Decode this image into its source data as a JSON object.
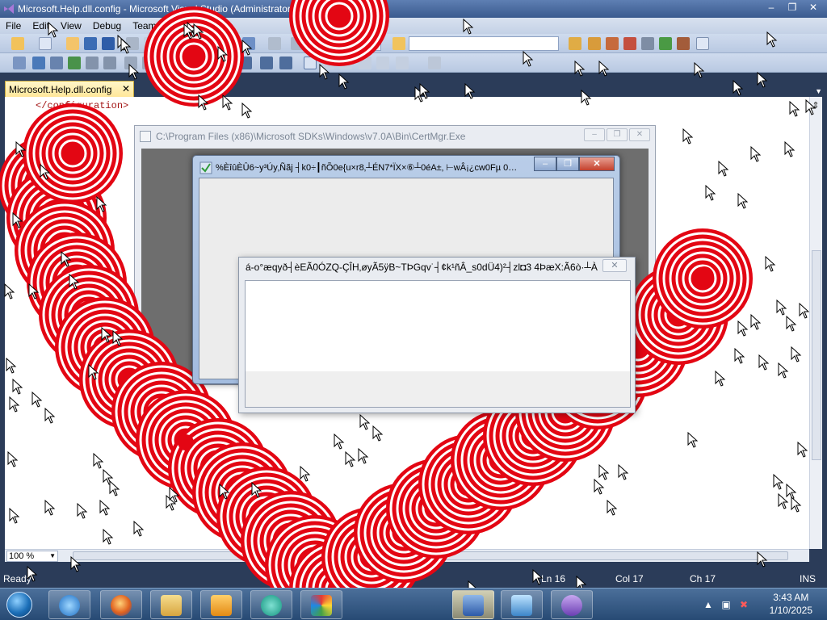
{
  "window": {
    "title": "Microsoft.Help.dll.config - Microsoft Visual Studio (Administrator)",
    "controls": [
      "–",
      "❐",
      "✕"
    ]
  },
  "menu": [
    "File",
    "Edit",
    "View",
    "Debug",
    "Team"
  ],
  "document_tab": {
    "label": "Microsoft.Help.dll.config",
    "close": "✕"
  },
  "editor": {
    "code": "</configuration>"
  },
  "zoom": "100 %",
  "status": {
    "ready": "Ready",
    "line": "Ln 16",
    "col": "Col 17",
    "ch": "Ch 17",
    "mode": "INS"
  },
  "dialogs": {
    "outer": {
      "title": "C:\\Program Files (x86)\\Microsoft SDKs\\Windows\\v7.0A\\Bin\\CertMgr.Exe",
      "buttons": [
        "–",
        "❐",
        "✕"
      ]
    },
    "middle": {
      "title": "%ÈîûÈÛ6~y³Úy‚Ñãj ┤k0÷┃ñÕ0e{u×r8‚┴ÉN7*ÏX×⑥┴0éA±‚ ⊢wÂ¡¿cw0Fµ 0…",
      "buttons": [
        "–",
        "❐",
        "✕"
      ]
    },
    "front": {
      "title": "á-o°æqyð┤èEÃ0ÓZQ-ÇÎH‚øyÃ5ÿB~TÞGqv˙┤¢k¹ñÂ_s0dÜ4)²┤zl◘3 4ÞæX:Ã6ò·┴À…",
      "close": "✕"
    }
  },
  "taskbar": {
    "apps": [
      "internet-explorer",
      "firefox",
      "file-explorer",
      "media-player",
      "app-green-circle",
      "app-colorful",
      "app-blue-package",
      "app-photo-viewer",
      "visual-studio"
    ],
    "clock_time": "3:43 AM",
    "clock_date": "1/10/2025"
  },
  "colors": {
    "accent": "#2b3c59",
    "artwork_red": "#e30613"
  }
}
